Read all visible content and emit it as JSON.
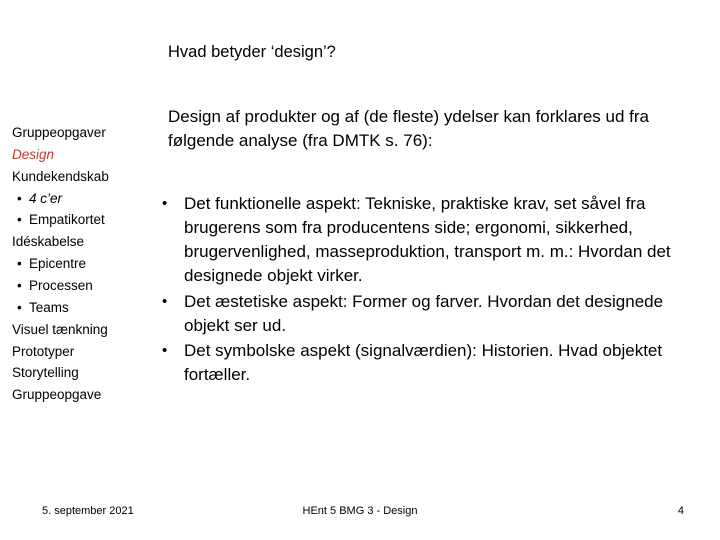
{
  "slide": {
    "title": "Hvad betyder ‘design’?",
    "sidebar": {
      "items": [
        {
          "label": "Gruppeopgaver",
          "style": "plain"
        },
        {
          "label": "Design",
          "style": "accent-italic"
        },
        {
          "label": "Kundekendskab",
          "style": "plain"
        },
        {
          "label": "4 c’er",
          "style": "bullet-italic"
        },
        {
          "label": "Empatikortet",
          "style": "bullet"
        },
        {
          "label": "Idéskabelse",
          "style": "plain"
        },
        {
          "label": "Epicentre",
          "style": "bullet"
        },
        {
          "label": "Processen",
          "style": "bullet"
        },
        {
          "label": "Teams",
          "style": "bullet"
        },
        {
          "label": "Visuel tænkning",
          "style": "plain"
        },
        {
          "label": "Prototyper",
          "style": "plain"
        },
        {
          "label": "Storytelling",
          "style": "plain"
        },
        {
          "label": "Gruppeopgave",
          "style": "plain"
        }
      ],
      "bullet_glyph": "•"
    },
    "intro": "Design af produkter og af (de fleste) ydelser kan forklares ud fra følgende analyse (fra DMTK s. 76):",
    "bullets": [
      {
        "marker": "•",
        "text": "Det funktionelle aspekt: Tekniske, praktiske krav, set såvel fra brugerens som fra producentens side; ergonomi, sikkerhed, brugervenlighed, masseproduktion, transport m. m.: Hvordan det designede objekt virker."
      },
      {
        "marker": "•",
        "text": "Det æstetiske aspekt: Former og farver. Hvordan det designede objekt ser ud."
      },
      {
        "marker": "•",
        "text": "Det symbolske aspekt (signalværdien): Historien. Hvad objektet fortæller."
      }
    ],
    "footer": {
      "date": "5. september 2021",
      "center": "HEnt 5 BMG 3 -  Design",
      "page_number": "4"
    },
    "colors": {
      "accent": "#C0392B",
      "text": "#000000",
      "background": "#FFFFFF"
    }
  }
}
